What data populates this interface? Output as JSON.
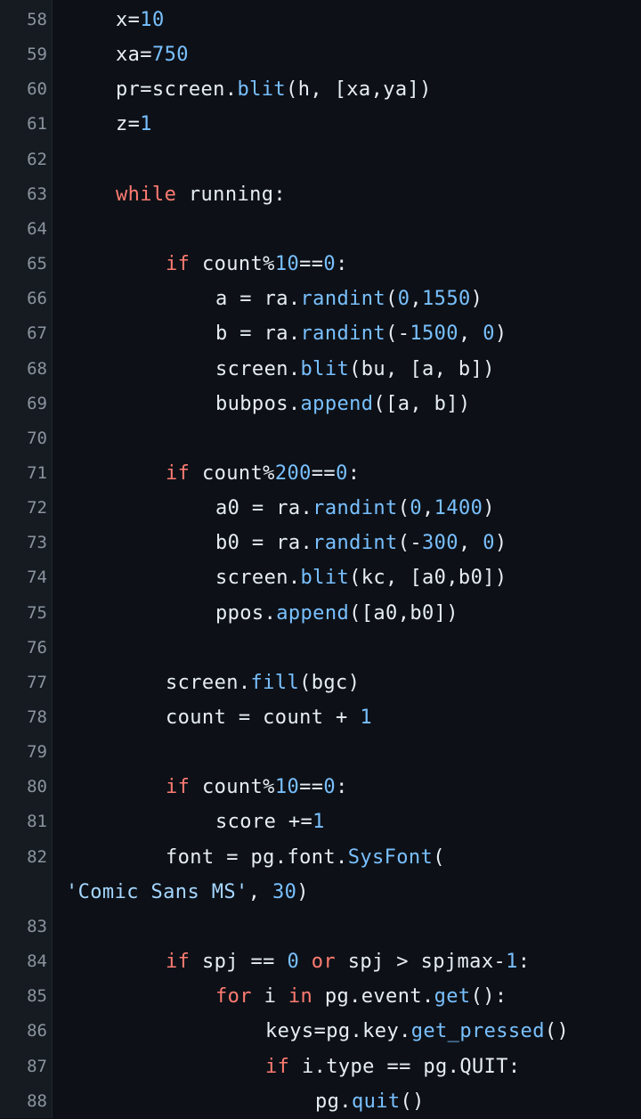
{
  "lines": [
    {
      "n": "58",
      "ind": 1,
      "t": [
        [
          "x=",
          ""
        ],
        [
          "10",
          "num"
        ]
      ]
    },
    {
      "n": "59",
      "ind": 1,
      "t": [
        [
          "xa=",
          ""
        ],
        [
          "750",
          "num"
        ]
      ]
    },
    {
      "n": "60",
      "ind": 1,
      "t": [
        [
          "pr=screen.",
          ""
        ],
        [
          "blit",
          "prop"
        ],
        [
          "(h, [xa,ya])",
          ""
        ]
      ]
    },
    {
      "n": "61",
      "ind": 1,
      "t": [
        [
          "z=",
          ""
        ],
        [
          "1",
          "num"
        ]
      ]
    },
    {
      "n": "62",
      "ind": 0,
      "t": []
    },
    {
      "n": "63",
      "ind": 1,
      "t": [
        [
          "while",
          "kw"
        ],
        [
          " running:",
          ""
        ]
      ]
    },
    {
      "n": "64",
      "ind": 0,
      "t": []
    },
    {
      "n": "65",
      "ind": 2,
      "t": [
        [
          "if",
          "kw"
        ],
        [
          " count%",
          ""
        ],
        [
          "10",
          "num"
        ],
        [
          "==",
          ""
        ],
        [
          "0",
          "num"
        ],
        [
          ":",
          ""
        ]
      ]
    },
    {
      "n": "66",
      "ind": 3,
      "t": [
        [
          "a = ra.",
          ""
        ],
        [
          "randint",
          "prop"
        ],
        [
          "(",
          ""
        ],
        [
          "0",
          "num"
        ],
        [
          ",",
          ""
        ],
        [
          "1550",
          "num"
        ],
        [
          ")",
          ""
        ]
      ]
    },
    {
      "n": "67",
      "ind": 3,
      "t": [
        [
          "b = ra.",
          ""
        ],
        [
          "randint",
          "prop"
        ],
        [
          "(-",
          ""
        ],
        [
          "1500",
          "num"
        ],
        [
          ", ",
          ""
        ],
        [
          "0",
          "num"
        ],
        [
          ")",
          ""
        ]
      ]
    },
    {
      "n": "68",
      "ind": 3,
      "t": [
        [
          "screen.",
          ""
        ],
        [
          "blit",
          "prop"
        ],
        [
          "(bu, [a, b])",
          ""
        ]
      ]
    },
    {
      "n": "69",
      "ind": 3,
      "t": [
        [
          "bubpos.",
          ""
        ],
        [
          "append",
          "prop"
        ],
        [
          "([a, b])",
          ""
        ]
      ]
    },
    {
      "n": "70",
      "ind": 0,
      "t": []
    },
    {
      "n": "71",
      "ind": 2,
      "t": [
        [
          "if",
          "kw"
        ],
        [
          " count%",
          ""
        ],
        [
          "200",
          "num"
        ],
        [
          "==",
          ""
        ],
        [
          "0",
          "num"
        ],
        [
          ":",
          ""
        ]
      ]
    },
    {
      "n": "72",
      "ind": 3,
      "t": [
        [
          "a0 = ra.",
          ""
        ],
        [
          "randint",
          "prop"
        ],
        [
          "(",
          ""
        ],
        [
          "0",
          "num"
        ],
        [
          ",",
          ""
        ],
        [
          "1400",
          "num"
        ],
        [
          ")",
          ""
        ]
      ]
    },
    {
      "n": "73",
      "ind": 3,
      "t": [
        [
          "b0 = ra.",
          ""
        ],
        [
          "randint",
          "prop"
        ],
        [
          "(-",
          ""
        ],
        [
          "300",
          "num"
        ],
        [
          ", ",
          ""
        ],
        [
          "0",
          "num"
        ],
        [
          ")",
          ""
        ]
      ]
    },
    {
      "n": "74",
      "ind": 3,
      "t": [
        [
          "screen.",
          ""
        ],
        [
          "blit",
          "prop"
        ],
        [
          "(kc, [a0,b0])",
          ""
        ]
      ]
    },
    {
      "n": "75",
      "ind": 3,
      "t": [
        [
          "ppos.",
          ""
        ],
        [
          "append",
          "prop"
        ],
        [
          "([a0,b0])",
          ""
        ]
      ]
    },
    {
      "n": "76",
      "ind": 0,
      "t": []
    },
    {
      "n": "77",
      "ind": 2,
      "t": [
        [
          "screen.",
          ""
        ],
        [
          "fill",
          "prop"
        ],
        [
          "(bgc)",
          ""
        ]
      ]
    },
    {
      "n": "78",
      "ind": 2,
      "t": [
        [
          "count = count + ",
          ""
        ],
        [
          "1",
          "num"
        ]
      ]
    },
    {
      "n": "79",
      "ind": 0,
      "t": []
    },
    {
      "n": "80",
      "ind": 2,
      "t": [
        [
          "if",
          "kw"
        ],
        [
          " count%",
          ""
        ],
        [
          "10",
          "num"
        ],
        [
          "==",
          ""
        ],
        [
          "0",
          "num"
        ],
        [
          ":",
          ""
        ]
      ]
    },
    {
      "n": "81",
      "ind": 3,
      "t": [
        [
          "score +=",
          ""
        ],
        [
          "1",
          "num"
        ]
      ]
    },
    {
      "n": "82",
      "ind": 2,
      "t": [
        [
          "font = pg.font.",
          ""
        ],
        [
          "SysFont",
          "prop"
        ],
        [
          "(",
          ""
        ]
      ]
    },
    {
      "n": "",
      "ind": 0,
      "t": [
        [
          "'Comic Sans MS'",
          "str"
        ],
        [
          ", ",
          ""
        ],
        [
          "30",
          "num"
        ],
        [
          ")",
          ""
        ]
      ]
    },
    {
      "n": "83",
      "ind": 0,
      "t": []
    },
    {
      "n": "84",
      "ind": 2,
      "t": [
        [
          "if",
          "kw"
        ],
        [
          " spj == ",
          ""
        ],
        [
          "0",
          "num"
        ],
        [
          " ",
          ""
        ],
        [
          "or",
          "kw"
        ],
        [
          " spj > spjmax-",
          ""
        ],
        [
          "1",
          "num"
        ],
        [
          ":",
          ""
        ]
      ]
    },
    {
      "n": "85",
      "ind": 3,
      "t": [
        [
          "for",
          "kw"
        ],
        [
          " i ",
          ""
        ],
        [
          "in",
          "kw"
        ],
        [
          " pg.event.",
          ""
        ],
        [
          "get",
          "prop"
        ],
        [
          "():",
          ""
        ]
      ]
    },
    {
      "n": "86",
      "ind": 4,
      "t": [
        [
          "keys=pg.key.",
          ""
        ],
        [
          "get_pressed",
          "prop"
        ],
        [
          "()",
          ""
        ]
      ]
    },
    {
      "n": "87",
      "ind": 4,
      "t": [
        [
          "if",
          "kw"
        ],
        [
          " i.type == pg.QUIT:",
          ""
        ]
      ]
    },
    {
      "n": "88",
      "ind": 5,
      "t": [
        [
          "pg.",
          ""
        ],
        [
          "quit",
          "prop"
        ],
        [
          "()",
          ""
        ]
      ]
    }
  ]
}
